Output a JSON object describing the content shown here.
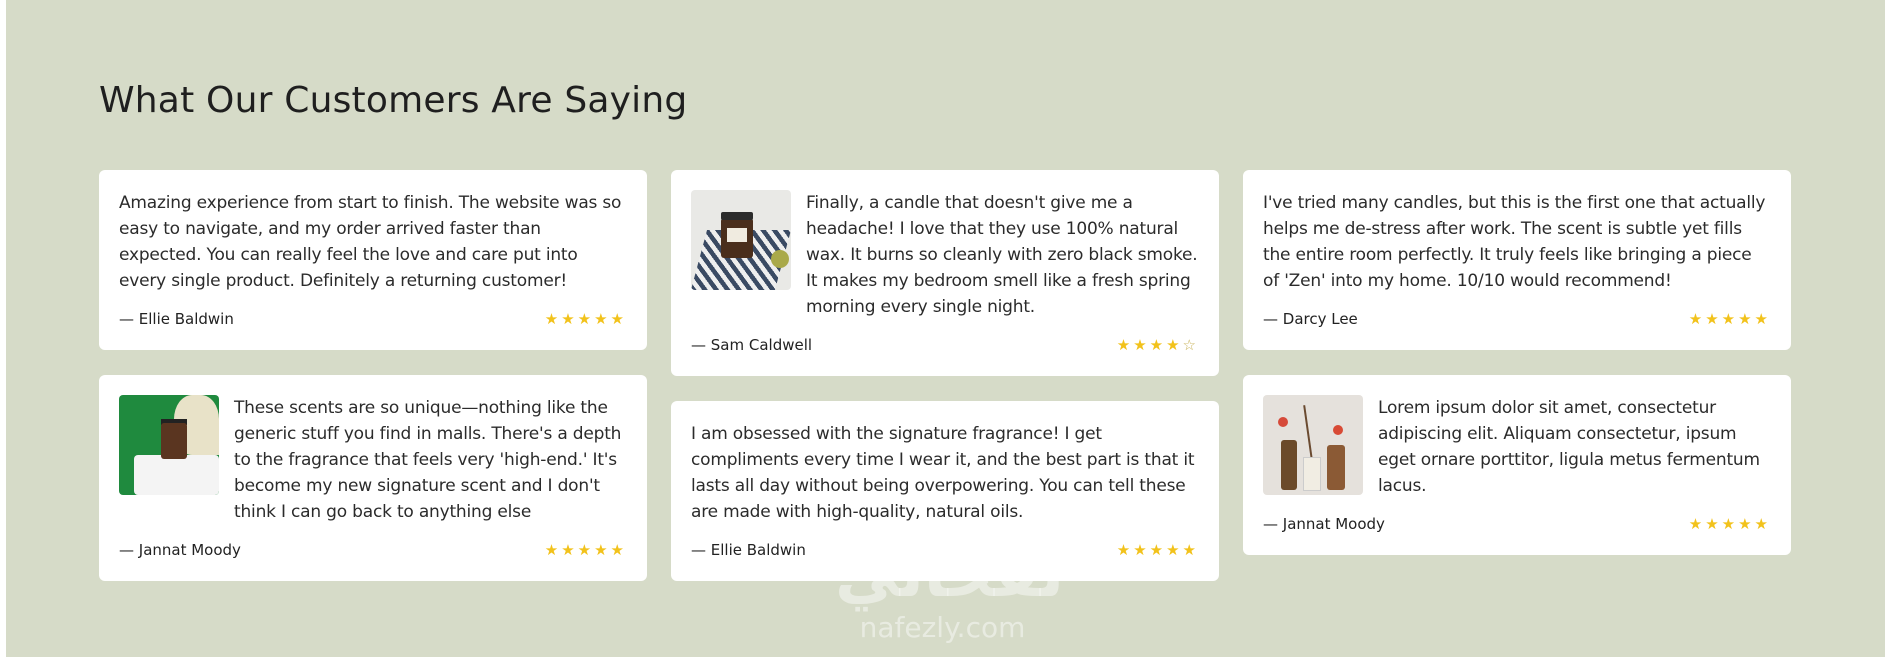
{
  "section": {
    "title": "What Our Customers Are Saying"
  },
  "columns": [
    [
      {
        "text": "Amazing experience from start to finish. The website was so easy to navigate, and my order arrived faster than expected. You can really feel the love and care put into every single product. Definitely a returning customer!",
        "author": "— Ellie Baldwin",
        "stars": "★★★★★",
        "image": null
      },
      {
        "text": "These scents are so unique—nothing like the generic stuff you find in malls. There's a depth to the fragrance that feels very 'high-end.' It's become my new signature scent and I don't think I can go back to anything else",
        "author": "— Jannat Moody",
        "stars": "★★★★★",
        "image": "candle-on-gift-box"
      }
    ],
    [
      {
        "text": "Finally, a candle that doesn't give me a headache! I love that they use 100% natural wax. It burns so cleanly with zero black smoke. It makes my bedroom smell like a fresh spring morning every single night.",
        "author": "— Sam Caldwell",
        "stars": "★★★★",
        "stars_empty": "☆",
        "image": "candle-on-tile-plate"
      },
      {
        "text": "I am obsessed with the signature fragrance! I get compliments every time I wear it, and the best part is that it lasts all day without being overpowering. You can tell these are made with high-quality, natural oils.",
        "author": "— Ellie Baldwin",
        "stars": "★★★★★",
        "image": null
      }
    ],
    [
      {
        "text": "I've tried many candles, but this is the first one that actually helps me de-stress after work. The scent is subtle yet fills the entire room perfectly. It truly feels like bringing a piece of 'Zen' into my home. 10/10 would recommend!",
        "author": "— Darcy Lee",
        "stars": "★★★★★",
        "image": null
      },
      {
        "text": "Lorem ipsum dolor sit amet, consectetur adipiscing elit. Aliquam consectetur, ipsum eget ornare porttitor, ligula metus fermentum lacus.",
        "author": "— Jannat Moody",
        "stars": "★★★★★",
        "image": "diffuser-bottles"
      }
    ]
  ],
  "watermark": {
    "arabic": "نفخاني",
    "latin": "nafezly.com"
  },
  "colors": {
    "background": "#d6dbc8",
    "card": "#ffffff",
    "star": "#f2c21b"
  }
}
